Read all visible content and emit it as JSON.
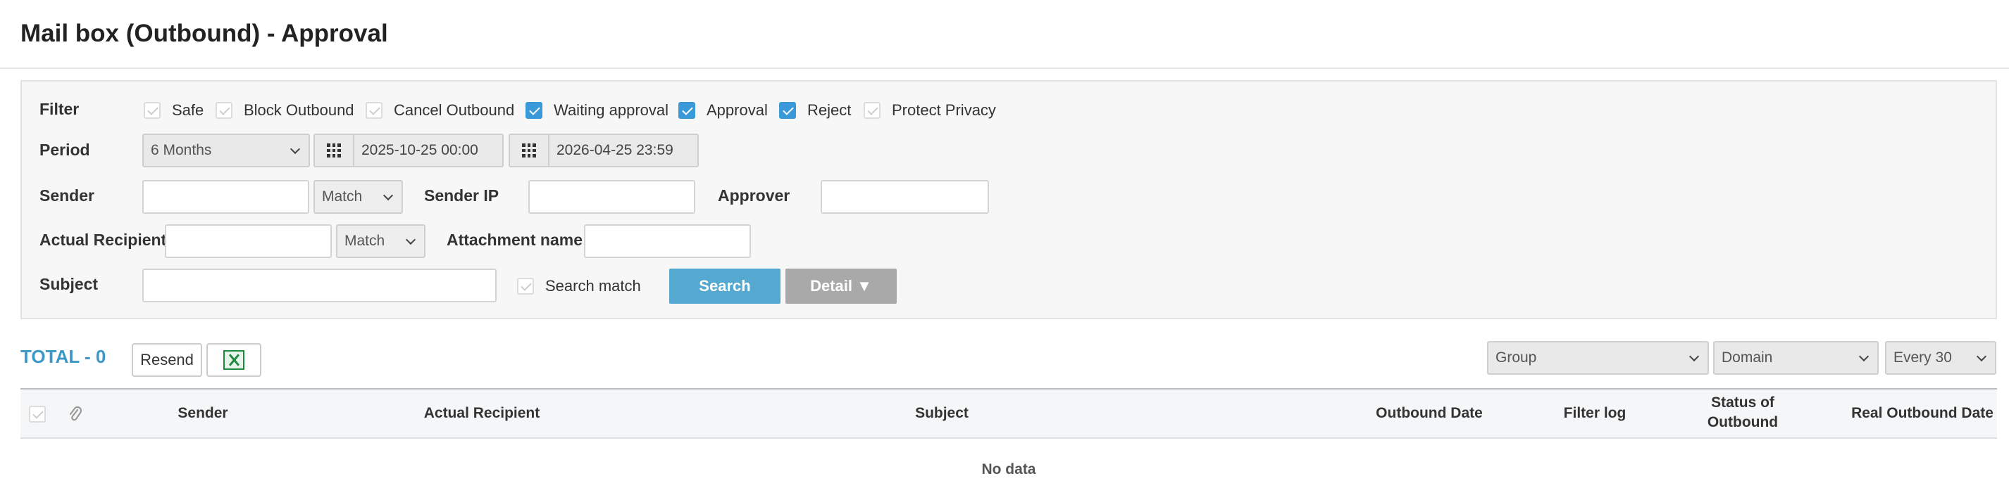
{
  "page": {
    "title": "Mail box (Outbound) - Approval"
  },
  "filter": {
    "label": "Filter",
    "options": [
      {
        "label": "Safe",
        "checked": false
      },
      {
        "label": "Block Outbound",
        "checked": false
      },
      {
        "label": "Cancel Outbound",
        "checked": false
      },
      {
        "label": "Waiting approval",
        "checked": true
      },
      {
        "label": "Approval",
        "checked": true
      },
      {
        "label": "Reject",
        "checked": true
      },
      {
        "label": "Protect Privacy",
        "checked": false
      }
    ]
  },
  "period": {
    "label": "Period",
    "range": "6 Months",
    "start": "2025-10-25 00:00",
    "end": "2026-04-25 23:59"
  },
  "sender": {
    "label": "Sender",
    "value": "",
    "match": "Match"
  },
  "sender_ip": {
    "label": "Sender IP",
    "value": ""
  },
  "approver": {
    "label": "Approver",
    "value": ""
  },
  "actual_recipient": {
    "label": "Actual Recipient",
    "value": "",
    "match": "Match"
  },
  "attachment": {
    "label": "Attachment name",
    "value": ""
  },
  "subject": {
    "label": "Subject",
    "value": ""
  },
  "search_match": {
    "label": "Search match",
    "checked": false
  },
  "buttons": {
    "search": "Search",
    "detail": "Detail ▼",
    "resend": "Resend"
  },
  "total": {
    "label": "TOTAL - 0"
  },
  "toolbar_selects": {
    "group": "Group",
    "domain": "Domain",
    "per_page": "Every 30"
  },
  "table": {
    "columns": {
      "sender": "Sender",
      "actual_recipient": "Actual Recipient",
      "subject": "Subject",
      "outbound_date": "Outbound Date",
      "filter_log": "Filter log",
      "status_line1": "Status of",
      "status_line2": "Outbound",
      "real_outbound_date": "Real Outbound Date"
    },
    "empty_text": "No data"
  },
  "icons": {
    "calendar": "grid-icon",
    "excel": "excel-icon",
    "attachment": "paperclip-icon"
  }
}
